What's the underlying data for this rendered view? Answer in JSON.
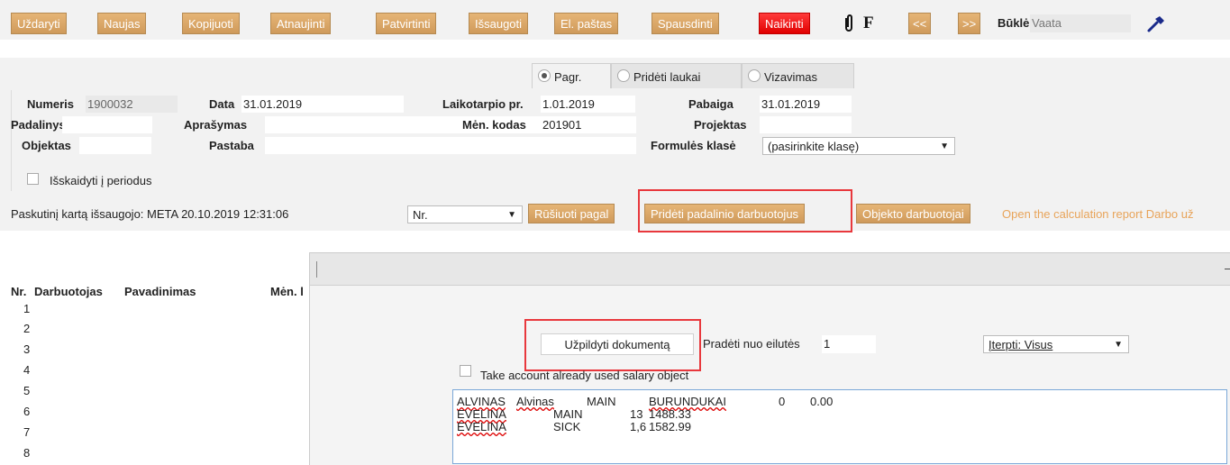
{
  "toolbar": {
    "buttons": [
      "Uždaryti",
      "Naujas",
      "Kopijuoti",
      "Atnaujinti",
      "Patvirtinti",
      "Išsaugoti",
      "El. paštas",
      "Spausdinti"
    ],
    "delete_label": "Naikinti",
    "f_label": "F",
    "prev_label": "<<",
    "next_label": ">>",
    "status_label": "Būklė:",
    "status_value": "Vaata",
    "accent": "#cf9a5b",
    "danger": "#e10000"
  },
  "tabs": [
    "Pagr.",
    "Pridėti laukai",
    "Vizavimas"
  ],
  "form": {
    "numeris_label": "Numeris",
    "numeris_value": "1900032",
    "data_label": "Data",
    "data_value": "31.01.2019",
    "laikotarpio_label": "Laikotarpio pr.",
    "laikotarpio_value": "1.01.2019",
    "pabaiga_label": "Pabaiga",
    "pabaiga_value": "31.01.2019",
    "padalinys_label": "Padalinys",
    "aprasymas_label": "Aprašymas",
    "men_kodas_label": "Mėn. kodas",
    "men_kodas_value": "201901",
    "projektas_label": "Projektas",
    "objektas_label": "Objektas",
    "pastaba_label": "Pastaba",
    "formules_label": "Formulės klasė",
    "formules_value": "(pasirinkite klasę)",
    "isskaidyti_label": "Išskaidyti į periodus"
  },
  "bar": {
    "saved_text": "Paskutinį kartą išsaugojo: META 20.10.2019 12:31:06",
    "sort_value": "Nr.",
    "sort_button": "Rūšiuoti pagal",
    "add_employees_button": "Pridėti padalinio darbuotojus",
    "object_employees_button": "Objekto darbuotojai",
    "report_link": "Open the calculation report Darbo už"
  },
  "grid": {
    "col_nr": "Nr.",
    "col_darbuotojas": "Darbuotojas",
    "col_pavadinimas": "Pavadinimas",
    "col_men": "Mėn. l",
    "rows": [
      "1",
      "2",
      "3",
      "4",
      "5",
      "6",
      "7",
      "8"
    ]
  },
  "dialog": {
    "fill_button": "Užpildyti dokumentą",
    "start_label": "Pradėti nuo eilutės",
    "start_value": "1",
    "insert_value": "Įterpti: Visus",
    "take_account_label": "Take account already used salary object",
    "lines": [
      [
        "ALVINAS",
        "Alvinas",
        "MAIN",
        "BURUNDUKAI",
        "0",
        "0.00"
      ],
      [
        "EVELINA",
        "MAIN",
        "13",
        "1488.33"
      ],
      [
        "EVELINA",
        "SICK",
        "1,6",
        "1582.99"
      ]
    ]
  }
}
